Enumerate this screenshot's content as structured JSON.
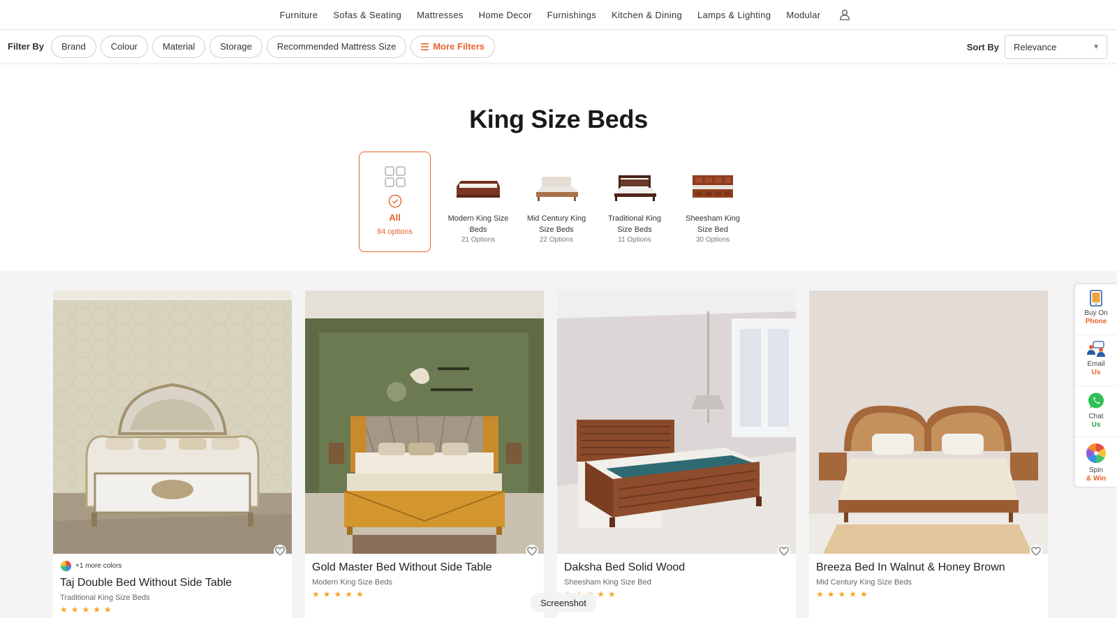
{
  "nav": {
    "items": [
      "Furniture",
      "Sofas & Seating",
      "Mattresses",
      "Home Decor",
      "Furnishings",
      "Kitchen & Dining",
      "Lamps & Lighting",
      "Modular"
    ],
    "user_icon": "user-icon"
  },
  "filters": {
    "label": "Filter By",
    "chips": [
      "Brand",
      "Colour",
      "Material",
      "Storage",
      "Recommended Mattress Size"
    ],
    "more_label": "More Filters",
    "sort_label": "Sort By",
    "sort_value": "Relevance"
  },
  "page": {
    "title": "King Size Beds"
  },
  "categories": {
    "all": {
      "name": "All",
      "count": "84 options"
    },
    "items": [
      {
        "name": "Modern King Size Beds",
        "count": "21 Options"
      },
      {
        "name": "Mid Century King Size Beds",
        "count": "22 Options"
      },
      {
        "name": "Traditional King Size Beds",
        "count": "11 Options"
      },
      {
        "name": "Sheesham King Size Bed",
        "count": "30 Options"
      }
    ]
  },
  "products": [
    {
      "title": "Taj Double Bed Without Side Table",
      "subtitle": "Traditional King Size Beds",
      "colors": "+1 more colors",
      "stars": "★★★★★"
    },
    {
      "title": "Gold Master Bed Without Side Table",
      "subtitle": "Modern King Size Beds",
      "stars": "★★★★★"
    },
    {
      "title": "Daksha Bed Solid Wood",
      "subtitle": "Sheesham King Size Bed",
      "stars": "★★★★★"
    },
    {
      "title": "Breeza Bed In Walnut & Honey Brown",
      "subtitle": "Mid Century King Size Beds",
      "stars": "★★★★★"
    }
  ],
  "float": {
    "phone": {
      "line1": "Buy On",
      "line2": "Phone"
    },
    "email": {
      "line1": "Email",
      "line2": "Us"
    },
    "chat": {
      "line1": "Chat",
      "line2": "Us"
    },
    "spin": {
      "line1": "Spin",
      "line2": "& Win"
    }
  },
  "overlay": {
    "screenshot": "Screenshot"
  },
  "colors": {
    "accent": "#e8622b",
    "star": "#f5a623",
    "section_bg": "#f4f4f4"
  }
}
